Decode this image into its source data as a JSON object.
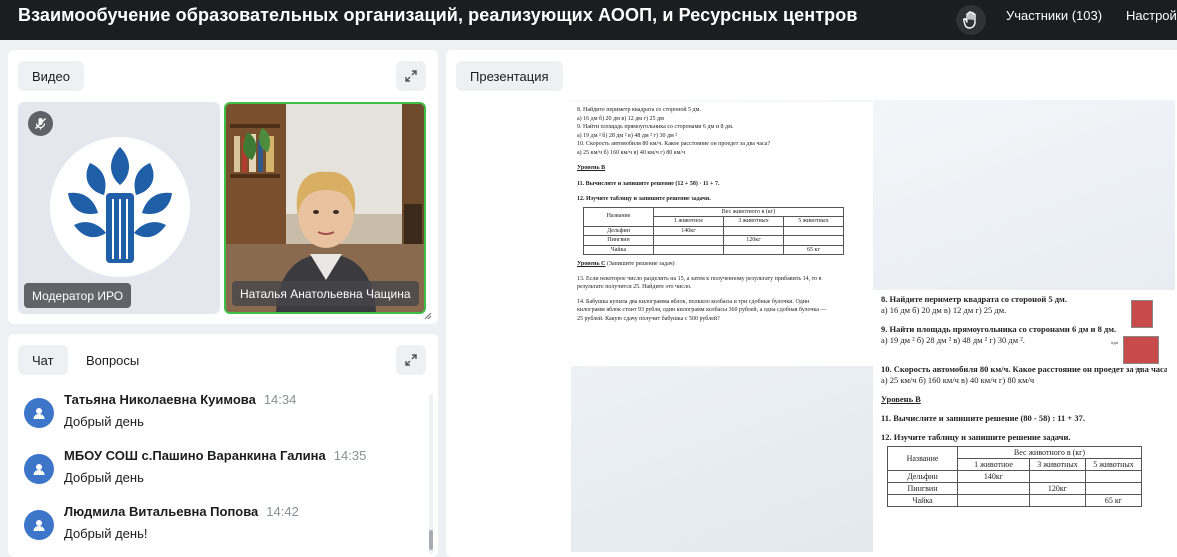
{
  "header": {
    "title": "Взаимообучение образовательных организаций, реализующих АООП, и Ресурсных центров",
    "participants_label": "Участники (103)",
    "settings_label": "Настрой"
  },
  "video": {
    "tab_label": "Видео",
    "tiles": [
      {
        "name": "Модератор ИРО",
        "mic": "muted"
      },
      {
        "name": "Наталья Анатольевна Чащина",
        "mic": "active"
      }
    ]
  },
  "chat": {
    "tabs": [
      {
        "label": "Чат"
      },
      {
        "label": "Вопросы"
      }
    ],
    "messages": [
      {
        "author": "Татьяна Николаевна Куимова",
        "time": "14:34",
        "text": "Добрый день"
      },
      {
        "author": "МБОУ СОШ с.Пашино Варанкина Галина",
        "time": "14:35",
        "text": "Добрый день"
      },
      {
        "author": "Людмила Витальевна Попова",
        "time": "14:42",
        "text": "Добрый день!"
      }
    ]
  },
  "presentation": {
    "tab_label": "Презентация",
    "page1": {
      "lines": [
        "8.   Найдите периметр квадрата со стороной 5 дм.",
        "   а) 16 дм           б) 20 дм             в) 12 дм              г) 25 дм",
        "9.   Найти площадь прямоугольника со сторонами 6 дм и 8 дм.",
        "   а) 19 дм ²         б) 28 дм ²           в) 48 дм ²            г) 30 дм ²",
        "10.  Скорость автомобиля 80 км/ч. Какое расстояние он проедет за два часа?",
        "   а) 25 км/ч          б) 160 км/ч          в) 40 км/ч            г) 80 км/ч"
      ],
      "level_b": "Уровень В",
      "task11": "11.  Вычислите и запишите решение (12 + 58) · 11 + 7.",
      "task12": "12.  Изучите таблицу и запишите решение задачи.",
      "table": {
        "head_name": "Название",
        "head_weight": "Вес животного в (кг)",
        "cols": [
          "1 животное",
          "3 животных",
          "5 животных"
        ],
        "rows": [
          {
            "name": "Дельфин",
            "c1": "140кг",
            "c2": "",
            "c3": ""
          },
          {
            "name": "Пингвин",
            "c1": "",
            "c2": "120кг",
            "c3": ""
          },
          {
            "name": "Чайка",
            "c1": "",
            "c2": "",
            "c3": "65 кг"
          }
        ]
      },
      "level_c": "Уровень С",
      "level_c_note": " (Запишите решение задач)",
      "task13": [
        "13.  Если некоторое число разделить на 15, а затем к полученному результату прибавить 14, то в",
        "результате получится 25. Найдите это число."
      ],
      "task14": [
        "14.  Бабушка купила два килограмма яблок, полкило колбасы и три сдобные булочки. Один",
        "килограмм яблок стоит 93 рубля, один килограмм колбасы 360 рублей, а одна сдобная булочка —",
        "25 рублей. Какую сдачу получит бабушка с 500 рублей?"
      ]
    },
    "page2": {
      "lines": [
        "8.   Найдите периметр квадрата со стороной 5 дм.",
        "   а) 16 дм      б) 20 дм          в) 12 дм            г) 25 дм.",
        "9.   Найти площадь прямоугольника со сторонами 6 дм и 8 дм.",
        "   а) 19 дм ²   б) 28 дм ²   в) 48 дм ²   г) 30 дм ².",
        "10.  Скорость автомобиля 80 км/ч. Какое расстояние он проедет за два часа?",
        "   а) 25 км/ч          б) 160 км/ч        в) 40 км/ч          г) 80 км/ч"
      ],
      "level_b": "Уровень В",
      "task11": "11.  Вычислите и запишите решение (80 - 58) : 11 + 37.",
      "task12": "12.  Изучите таблицу и запишите решение задачи.",
      "table": {
        "head_name": "Название",
        "head_weight": "Вес животного в (кг)",
        "cols": [
          "1 животное",
          "3 животных",
          "5 животных"
        ],
        "rows": [
          {
            "name": "Дельфин",
            "c1": "140кг",
            "c2": "",
            "c3": ""
          },
          {
            "name": "Пингвин",
            "c1": "",
            "c2": "120кг",
            "c3": ""
          },
          {
            "name": "Чайка",
            "c1": "",
            "c2": "",
            "c3": "65 кг"
          }
        ]
      },
      "side_label_1": "6дм",
      "side_label_2": "8дм"
    }
  },
  "colors": {
    "topbar": "#1c1d1f",
    "speaker_border": "#3fbf49",
    "avatar": "#3d75c9",
    "logo_blue": "#1f5fa8"
  }
}
